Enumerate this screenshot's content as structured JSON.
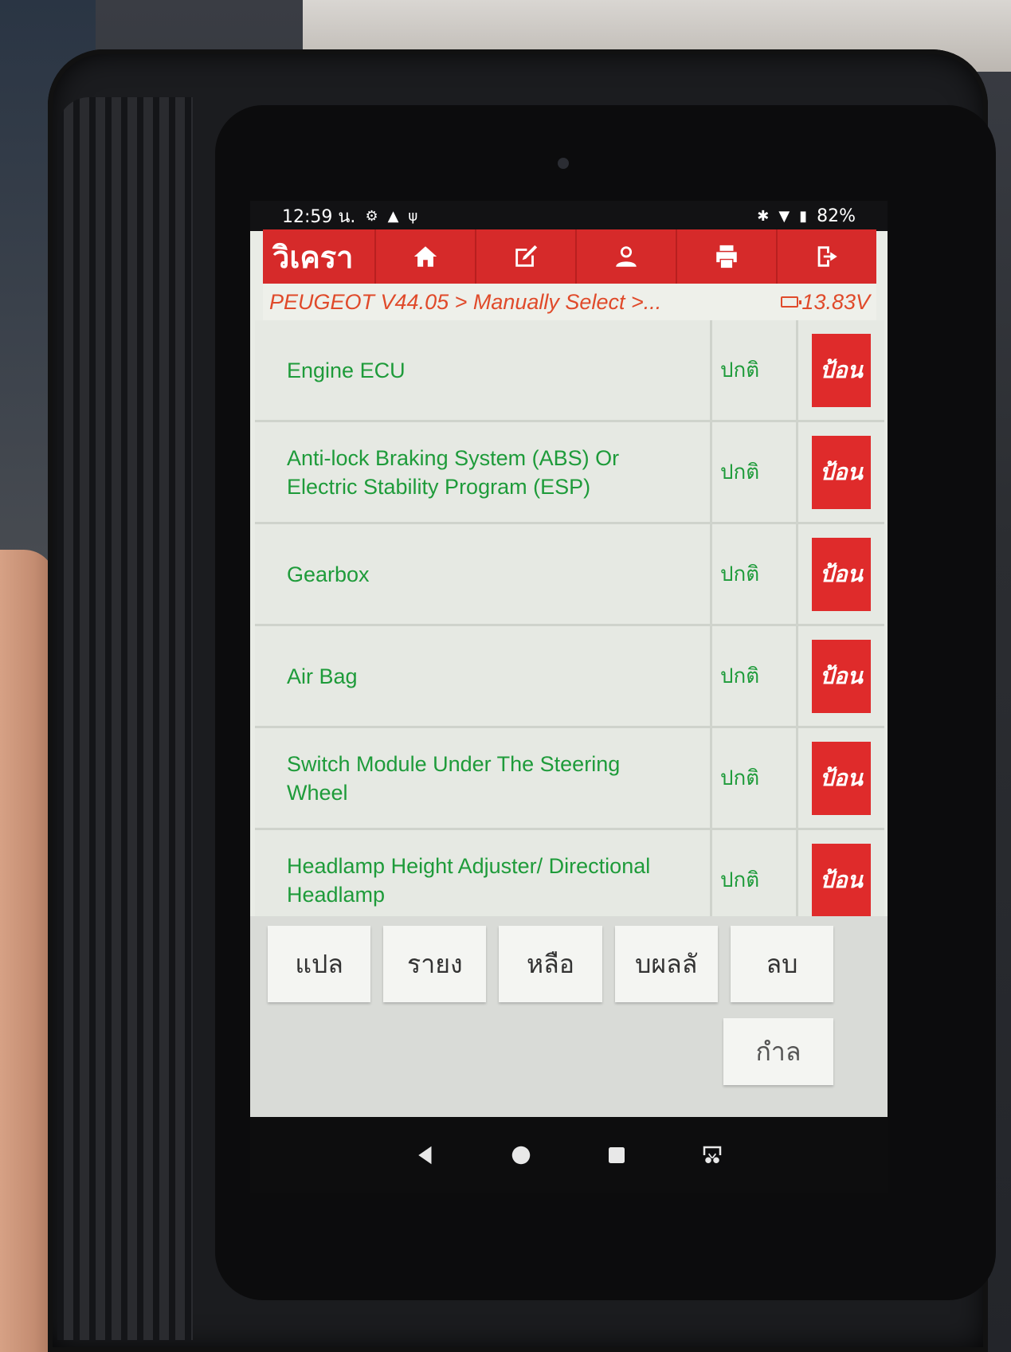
{
  "statusbar": {
    "time": "12:59 น.",
    "battery": "82%"
  },
  "toolbar": {
    "title": "วิเครา",
    "buttons": [
      {
        "icon": "home-icon"
      },
      {
        "icon": "edit-icon"
      },
      {
        "icon": "user-icon"
      },
      {
        "icon": "print-icon"
      },
      {
        "icon": "exit-icon"
      }
    ]
  },
  "breadcrumb": {
    "path": "PEUGEOT V44.05 > Manually Select >...",
    "voltage": "13.83V"
  },
  "systems": [
    {
      "name": "Engine ECU",
      "status": "ปกติ",
      "action": "ป้อน"
    },
    {
      "name": "Anti-lock Braking System (ABS) Or Electric Stability Program (ESP)",
      "status": "ปกติ",
      "action": "ป้อน"
    },
    {
      "name": "Gearbox",
      "status": "ปกติ",
      "action": "ป้อน"
    },
    {
      "name": "Air Bag",
      "status": "ปกติ",
      "action": "ป้อน"
    },
    {
      "name": "Switch Module Under The Steering Wheel",
      "status": "ปกติ",
      "action": "ป้อน"
    },
    {
      "name": "Headlamp Height Adjuster/ Directional Headlamp",
      "status": "ปกติ",
      "action": "ป้อน"
    }
  ],
  "bottom_buttons": [
    "แปล",
    "รายง",
    "หลือ",
    "บผลลั",
    "ลบ"
  ],
  "secondary_button": "กำล",
  "colors": {
    "accent": "#d62a2a",
    "text_green": "#1e9b3a",
    "breadcrumb": "#e04a2a"
  }
}
